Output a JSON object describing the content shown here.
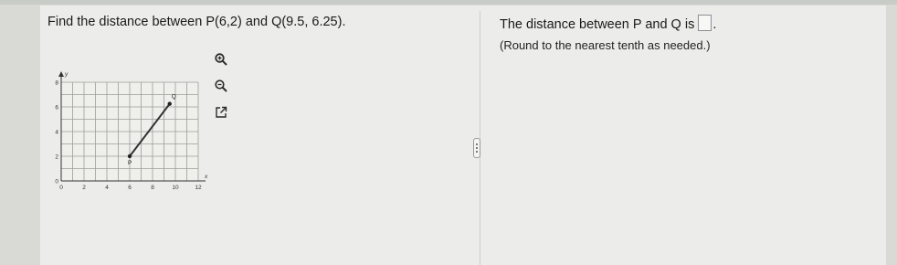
{
  "question": {
    "prefix": "Find the distance between ",
    "point_p": "P(6,2)",
    "connector": " and ",
    "point_q": "Q(9.5, 6.25)",
    "suffix": "."
  },
  "answer": {
    "sentence": "The distance between P and Q is",
    "value": "",
    "period": ".",
    "instruction": "(Round to the nearest tenth as needed.)"
  },
  "tools": {
    "zoom_in_icon": "zoom-in-icon",
    "zoom_out_icon": "zoom-out-icon",
    "popout_icon": "external-link-icon"
  },
  "graph": {
    "x_axis_label": "x",
    "y_axis_label": "y",
    "x_ticks": [
      "0",
      "2",
      "4",
      "6",
      "8",
      "10",
      "12"
    ],
    "y_ticks": [
      "0",
      "2",
      "4",
      "6",
      "8"
    ],
    "point_labels": [
      "P",
      "Q"
    ],
    "points": [
      {
        "name": "P",
        "x": 6,
        "y": 2
      },
      {
        "name": "Q",
        "x": 9.5,
        "y": 6.25
      }
    ],
    "xlim": [
      0,
      12
    ],
    "ylim": [
      0,
      8
    ],
    "grid_step": 1,
    "line_color": "#333333",
    "grid_color": "#9c9e9a"
  }
}
